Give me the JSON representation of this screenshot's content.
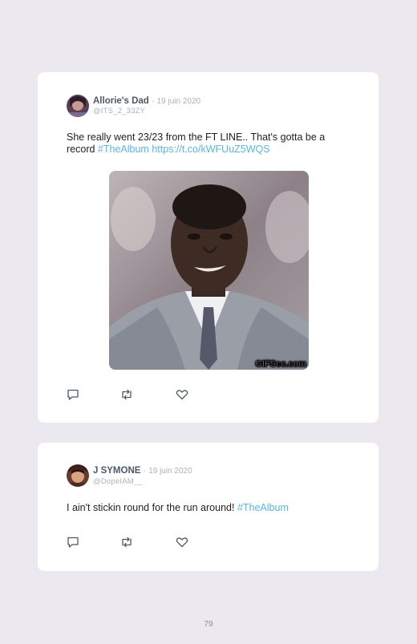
{
  "tweets": [
    {
      "name": "Allorie's Dad",
      "separator": "·",
      "date": "19 juin 2020",
      "handle": "@ITS_2_33ZY",
      "text": "She really went 23/23 from the FT LINE.. That's gotta be a record",
      "hashtag": "#TheAlbum",
      "url": "https://t.co/kWFUuZ5WQS",
      "media_watermark": "GIFSec.com"
    },
    {
      "name": "J SYMONE",
      "separator": "·",
      "date": "19 juin 2020",
      "handle": "@DopeIAM__",
      "text": "I ain't stickin round for the run around!",
      "hashtag": "#TheAlbum"
    }
  ],
  "actions": {
    "reply_icon": "reply-icon",
    "retweet_icon": "retweet-icon",
    "like_icon": "heart-icon"
  },
  "page_number": "79",
  "colors": {
    "background": "#ebe8ef",
    "card": "#ffffff",
    "link": "#5bb4e6",
    "name": "#4b5869",
    "meta": "#aab2bd"
  }
}
